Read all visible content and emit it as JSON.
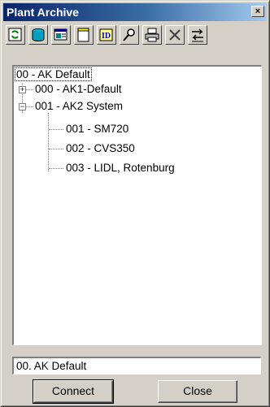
{
  "window": {
    "title": "Plant Archive",
    "close_glyph": "×"
  },
  "toolbar": {
    "buttons": [
      {
        "icon": "refresh-icon"
      },
      {
        "icon": "database-icon"
      },
      {
        "icon": "properties-icon"
      },
      {
        "icon": "new-document-icon"
      },
      {
        "icon": "id-icon",
        "label": "ID"
      },
      {
        "icon": "search-icon"
      },
      {
        "icon": "print-icon"
      },
      {
        "icon": "delete-icon"
      },
      {
        "icon": "transfer-icon"
      }
    ]
  },
  "tree": {
    "root": "00 - AK Default",
    "children": [
      {
        "label": "000 - AK1-Default",
        "expander": "+"
      },
      {
        "label": "001 - AK2 System",
        "expander": "−",
        "children": [
          {
            "label": "001 - SM720"
          },
          {
            "label": "002 - CVS350"
          },
          {
            "label": "003 - LIDL, Rotenburg"
          }
        ]
      }
    ]
  },
  "selection_field": {
    "value": "00. AK Default"
  },
  "buttons": {
    "connect": "Connect",
    "close": "Close"
  }
}
